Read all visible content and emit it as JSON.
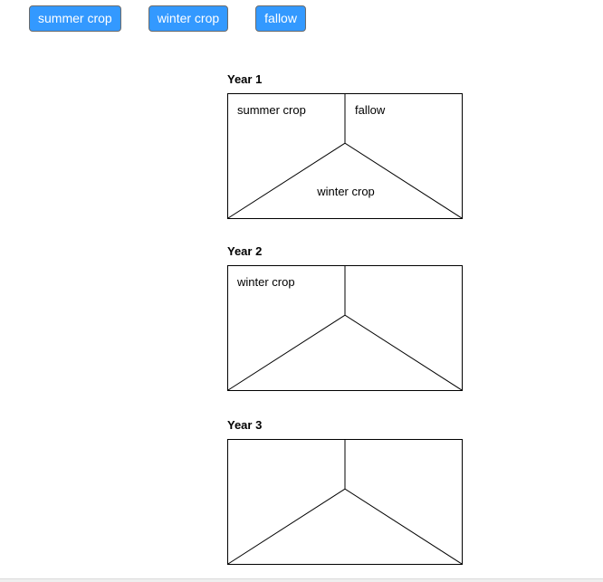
{
  "chips": {
    "summer": "summer crop",
    "winter": "winter crop",
    "fallow": "fallow"
  },
  "years": {
    "y1": {
      "title": "Year 1",
      "top_left": "summer crop",
      "top_right": "fallow",
      "bottom": "winter crop"
    },
    "y2": {
      "title": "Year 2",
      "top_left": "winter crop",
      "top_right": "",
      "bottom": ""
    },
    "y3": {
      "title": "Year 3",
      "top_left": "",
      "top_right": "",
      "bottom": ""
    }
  }
}
